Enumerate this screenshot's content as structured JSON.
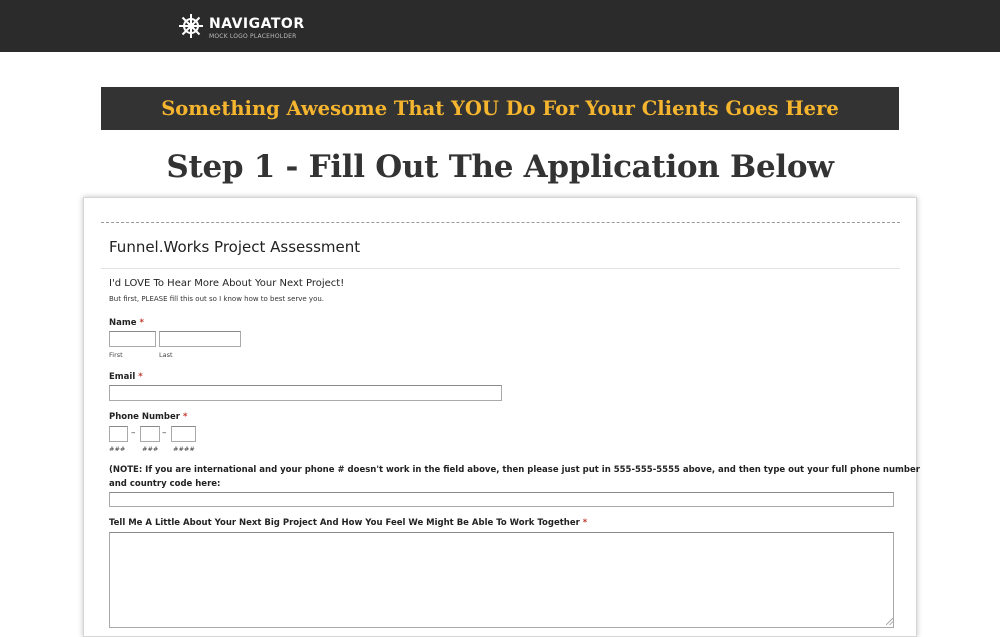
{
  "header": {
    "logo_title": "NAVIGATOR",
    "logo_subtitle": "MOCK LOGO PLACEHOLDER",
    "logo_icon": "ship-wheel-icon"
  },
  "banner": {
    "text": "Something Awesome That YOU Do For Your Clients Goes Here",
    "text_color": "#f5b52e",
    "background": "#333333"
  },
  "step_title": "Step 1 - Fill Out The Application Below",
  "form": {
    "title": "Funnel.Works Project Assessment",
    "intro_heading": "I'd LOVE To Hear More About Your Next Project!",
    "intro_subtext": "But first, PLEASE fill this out so I know how to best serve you.",
    "required_marker": "*",
    "name": {
      "label": "Name",
      "first_sublabel": "First",
      "last_sublabel": "Last",
      "first_value": "",
      "last_value": ""
    },
    "email": {
      "label": "Email",
      "value": ""
    },
    "phone": {
      "label": "Phone Number",
      "separator": "–",
      "area_sublabel": "###",
      "prefix_sublabel": "###",
      "line_sublabel": "####",
      "area_value": "",
      "prefix_value": "",
      "line_value": ""
    },
    "international_note": {
      "label_line1": "(NOTE: If you are international and your phone # doesn't work in the field above, then please just put in 555-555-5555 above, and then type out your full phone number",
      "label_line2": "and country code here:",
      "value": ""
    },
    "project": {
      "label": "Tell Me A Little About Your Next Big Project And How You Feel We Might Be Able To Work Together",
      "value": ""
    }
  }
}
